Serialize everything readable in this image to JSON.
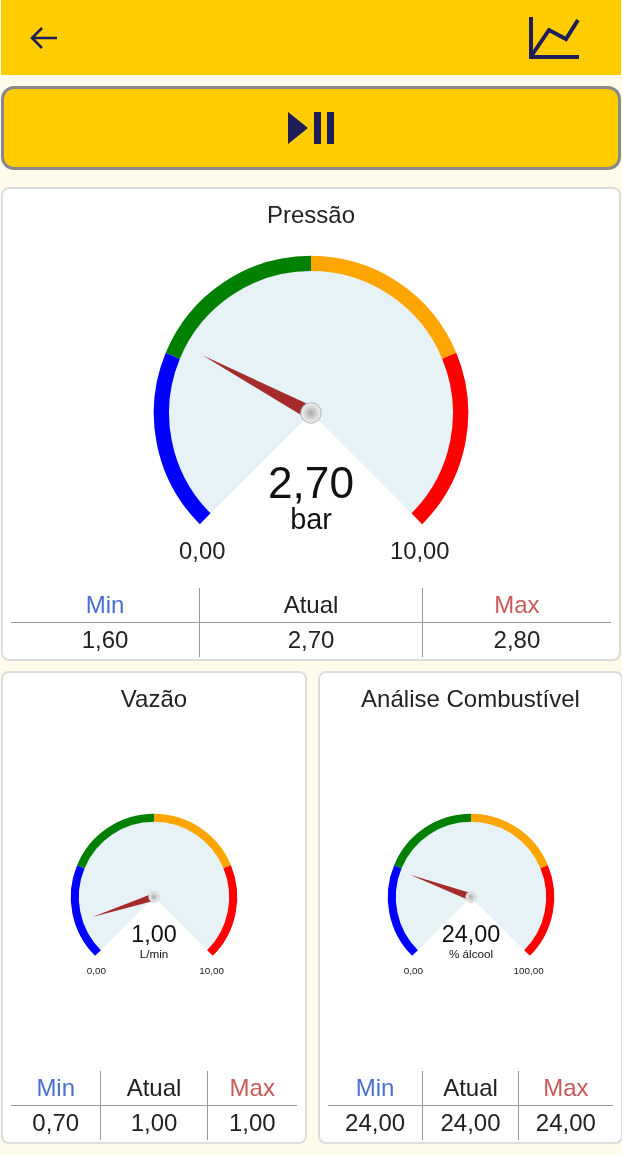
{
  "gauges": [
    {
      "title": "Pressão",
      "value": "2,70",
      "unit": "bar",
      "min_label": "0,00",
      "max_label": "10,00",
      "stats": [
        {
          "kind": "min",
          "label": "Min",
          "value": "1,60"
        },
        {
          "kind": "current",
          "label": "Atual",
          "value": "2,70"
        },
        {
          "kind": "max",
          "label": "Max",
          "value": "2,80"
        }
      ]
    },
    {
      "title": "Vazão",
      "value": "1,00",
      "unit": "L/min",
      "min_label": "0,00",
      "max_label": "10,00",
      "stats": [
        {
          "kind": "min",
          "label": "Min",
          "value": "0,70"
        },
        {
          "kind": "current",
          "label": "Atual",
          "value": "1,00"
        },
        {
          "kind": "max",
          "label": "Max",
          "value": "1,00"
        }
      ]
    },
    {
      "title": "Análise Combustível",
      "value": "24,00",
      "unit": "% álcool",
      "min_label": "0,00",
      "max_label": "100,00",
      "stats": [
        {
          "kind": "min",
          "label": "Min",
          "value": "24,00"
        },
        {
          "kind": "current",
          "label": "Atual",
          "value": "24,00"
        },
        {
          "kind": "max",
          "label": "Max",
          "value": "24,00"
        }
      ]
    }
  ]
}
